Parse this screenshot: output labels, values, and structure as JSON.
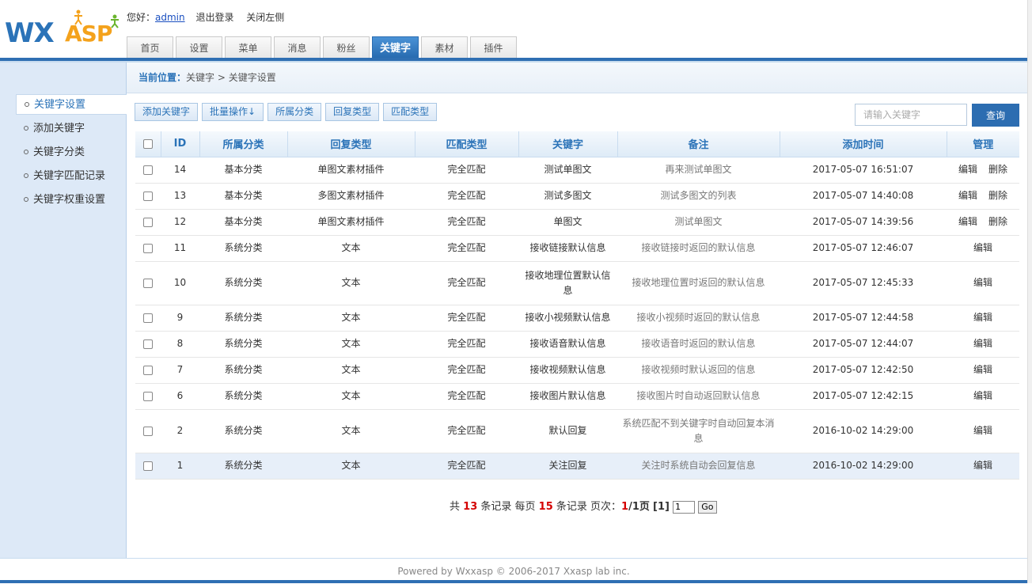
{
  "brand": {
    "logo_wx": "WX",
    "logo_asp": "ASP"
  },
  "userbar": {
    "greeting": "您好：",
    "username": "admin",
    "logout": "退出登录",
    "close_left": "关闭左侧"
  },
  "nav": {
    "tabs": [
      {
        "label": "首页"
      },
      {
        "label": "设置"
      },
      {
        "label": "菜单"
      },
      {
        "label": "消息"
      },
      {
        "label": "粉丝"
      },
      {
        "label": "关键字"
      },
      {
        "label": "素材"
      },
      {
        "label": "插件"
      }
    ],
    "active_index": 5
  },
  "sidebar": {
    "items": [
      {
        "label": "关键字设置"
      },
      {
        "label": "添加关键字"
      },
      {
        "label": "关键字分类"
      },
      {
        "label": "关键字匹配记录"
      },
      {
        "label": "关键字权重设置"
      }
    ]
  },
  "breadcrumb": {
    "label": "当前位置：",
    "path": "关键字 > 关键字设置"
  },
  "toolbar": {
    "buttons": [
      {
        "label": "添加关键字"
      },
      {
        "label": "批量操作↓"
      },
      {
        "label": "所属分类"
      },
      {
        "label": "回复类型"
      },
      {
        "label": "匹配类型"
      }
    ]
  },
  "search": {
    "placeholder": "请输入关键字",
    "button": "查询"
  },
  "table": {
    "headers": [
      "ID",
      "所属分类",
      "回复类型",
      "匹配类型",
      "关键字",
      "备注",
      "添加时间",
      "管理"
    ],
    "rows": [
      {
        "id": "14",
        "category": "基本分类",
        "reply_type": "单图文素材插件",
        "match_type": "完全匹配",
        "keyword": "测试单图文",
        "note": "再来测试单图文",
        "time": "2017-05-07 16:51:07",
        "actions": [
          "编辑",
          "删除"
        ]
      },
      {
        "id": "13",
        "category": "基本分类",
        "reply_type": "多图文素材插件",
        "match_type": "完全匹配",
        "keyword": "测试多图文",
        "note": "测试多图文的列表",
        "time": "2017-05-07 14:40:08",
        "actions": [
          "编辑",
          "删除"
        ]
      },
      {
        "id": "12",
        "category": "基本分类",
        "reply_type": "单图文素材插件",
        "match_type": "完全匹配",
        "keyword": "单图文",
        "note": "测试单图文",
        "time": "2017-05-07 14:39:56",
        "actions": [
          "编辑",
          "删除"
        ]
      },
      {
        "id": "11",
        "category": "系统分类",
        "reply_type": "文本",
        "match_type": "完全匹配",
        "keyword": "接收链接默认信息",
        "note": "接收链接时返回的默认信息",
        "time": "2017-05-07 12:46:07",
        "actions": [
          "编辑"
        ]
      },
      {
        "id": "10",
        "category": "系统分类",
        "reply_type": "文本",
        "match_type": "完全匹配",
        "keyword": "接收地理位置默认信息",
        "note": "接收地理位置时返回的默认信息",
        "time": "2017-05-07 12:45:33",
        "actions": [
          "编辑"
        ]
      },
      {
        "id": "9",
        "category": "系统分类",
        "reply_type": "文本",
        "match_type": "完全匹配",
        "keyword": "接收小视频默认信息",
        "note": "接收小视频时返回的默认信息",
        "time": "2017-05-07 12:44:58",
        "actions": [
          "编辑"
        ]
      },
      {
        "id": "8",
        "category": "系统分类",
        "reply_type": "文本",
        "match_type": "完全匹配",
        "keyword": "接收语音默认信息",
        "note": "接收语音时返回的默认信息",
        "time": "2017-05-07 12:44:07",
        "actions": [
          "编辑"
        ]
      },
      {
        "id": "7",
        "category": "系统分类",
        "reply_type": "文本",
        "match_type": "完全匹配",
        "keyword": "接收视频默认信息",
        "note": "接收视频时默认返回的信息",
        "time": "2017-05-07 12:42:50",
        "actions": [
          "编辑"
        ]
      },
      {
        "id": "6",
        "category": "系统分类",
        "reply_type": "文本",
        "match_type": "完全匹配",
        "keyword": "接收图片默认信息",
        "note": "接收图片时自动返回默认信息",
        "time": "2017-05-07 12:42:15",
        "actions": [
          "编辑"
        ]
      },
      {
        "id": "2",
        "category": "系统分类",
        "reply_type": "文本",
        "match_type": "完全匹配",
        "keyword": "默认回复",
        "note": "系统匹配不到关键字时自动回复本消息",
        "time": "2016-10-02 14:29:00",
        "actions": [
          "编辑"
        ]
      },
      {
        "id": "1",
        "category": "系统分类",
        "reply_type": "文本",
        "match_type": "完全匹配",
        "keyword": "关注回复",
        "note": "关注时系统自动会回复信息",
        "time": "2016-10-02 14:29:00",
        "actions": [
          "编辑"
        ]
      }
    ],
    "selected_row": 10
  },
  "pager": {
    "prefix": "共",
    "total": "13",
    "records_label": "条记录 每页",
    "per_page": "15",
    "records_label2": "条记录 页次：",
    "current": "1",
    "slash_total": "/1页",
    "page_link": "[1]",
    "input_value": "1",
    "go": "Go"
  },
  "footer": {
    "text": "Powered by Wxxasp © 2006-2017 Xxasp lab inc."
  },
  "colors": {
    "brand_blue": "#2f6fb3",
    "accent_orange": "#f4a21c",
    "highlight_red": "#d40000"
  }
}
